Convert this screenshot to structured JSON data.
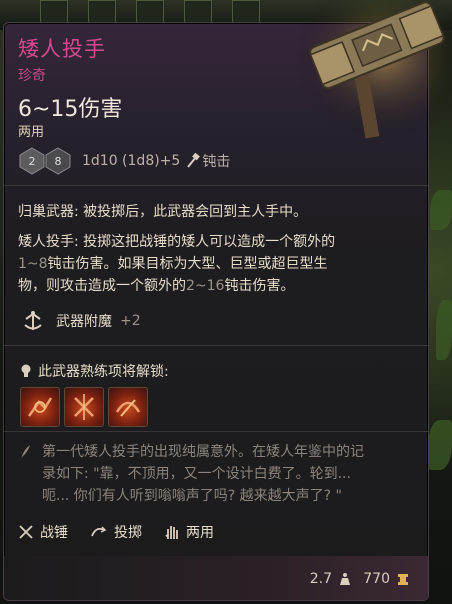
{
  "item": {
    "name": "矮人投手",
    "rarity": "珍奇",
    "damage": "6~15伤害",
    "handedness": "两用",
    "dice_formula": "1d10 (1d8)+5",
    "damage_type": "钝击",
    "dice_face_1": "2",
    "dice_face_2": "8"
  },
  "properties": {
    "homecoming_label": "归巢武器:",
    "homecoming_text": " 被投掷后，此武器会回到主人手中。",
    "dwarf_label": "矮人投手:",
    "dwarf_text_1": " 投掷这把战锤的矮人可以造成一个额外的",
    "dwarf_dmg_1": "1~8",
    "dwarf_text_2": "钝击伤害。如果目标为大型、巨型或超巨型生",
    "dwarf_text_3": "物，则攻击造成一个额外的",
    "dwarf_dmg_2": "2~16",
    "dwarf_text_4": "钝击伤害。"
  },
  "enchantment": {
    "label": "武器附魔",
    "value": "+2"
  },
  "proficiency": {
    "label": "此武器熟练项将解锁:",
    "actions": [
      "action-1",
      "action-2",
      "action-3"
    ]
  },
  "flavor": {
    "line1": "第一代矮人投手的出现纯属意外。在矮人年鉴中的记",
    "line2": "录如下: \"靠，不顶用，又一个设计白费了。轮到...",
    "line3": "呃... 你们有人听到嗡嗡声了吗? 越来越大声了? \""
  },
  "tags": {
    "warhammer": "战锤",
    "thrown": "投掷",
    "versatile": "两用"
  },
  "footer": {
    "weight": "2.7",
    "price": "770"
  },
  "colors": {
    "title": "#d24a8e",
    "rarity": "#c14a86",
    "body": "#e6dcc9",
    "dim": "#9c9389",
    "flavor": "#8c847c"
  }
}
